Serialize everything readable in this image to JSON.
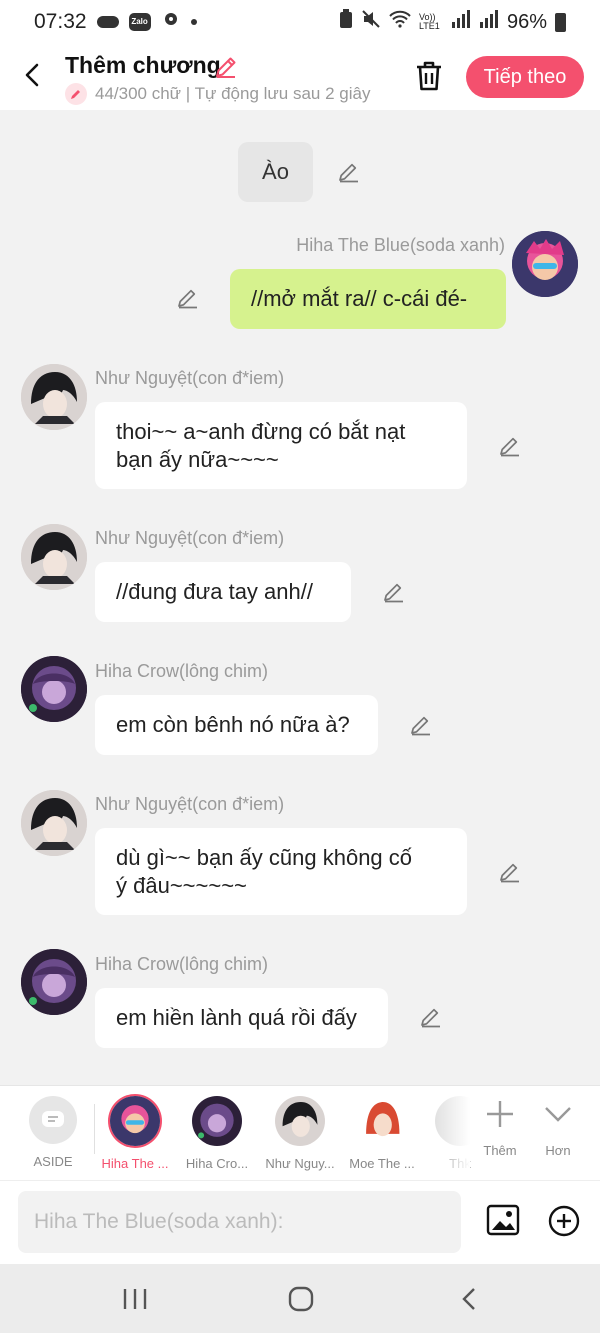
{
  "status": {
    "time": "07:32",
    "zalo": "Zalo",
    "network": "Vo)) LTE1",
    "battery": "96%"
  },
  "header": {
    "title": "Thêm chương",
    "subtitle": "44/300 chữ | Tự động lưu sau 2 giây",
    "next_label": "Tiếp theo"
  },
  "chat": {
    "narration": "Ào",
    "messages": [
      {
        "speaker": "Hiha The Blue(soda xanh)",
        "text": "//mở mắt ra// c-cái đé-",
        "self": true
      },
      {
        "speaker": "Như Nguyệt(con đ*iem)",
        "line1": "thoi~~ a~anh đừng có bắt nạt",
        "line2": "bạn ấy nữa~~~~"
      },
      {
        "speaker": "Như Nguyệt(con đ*iem)",
        "text": "//đung đưa tay anh//"
      },
      {
        "speaker": "Hiha Crow(lông chim)",
        "text": "em còn bênh nó nữa à?"
      },
      {
        "speaker": "Như Nguyệt(con đ*iem)",
        "line1": "dù gì~~ bạn ấy cũng không cố",
        "line2": "ý đâu~~~~~~"
      },
      {
        "speaker": "Hiha Crow(lông chim)",
        "text": "em hiền lành quá rồi đấy"
      }
    ]
  },
  "characters": {
    "aside": "ASIDE",
    "items": [
      "Hiha The ...",
      "Hiha Cro...",
      "Như Nguy...",
      "Moe The ...",
      "Thk"
    ],
    "add_label": "Thêm",
    "more_label": "Hơn"
  },
  "input": {
    "placeholder": "Hiha The Blue(soda xanh):"
  },
  "colors": {
    "accent": "#f4506e",
    "self_bubble": "#d6f28e",
    "background": "#f2f2f2"
  }
}
